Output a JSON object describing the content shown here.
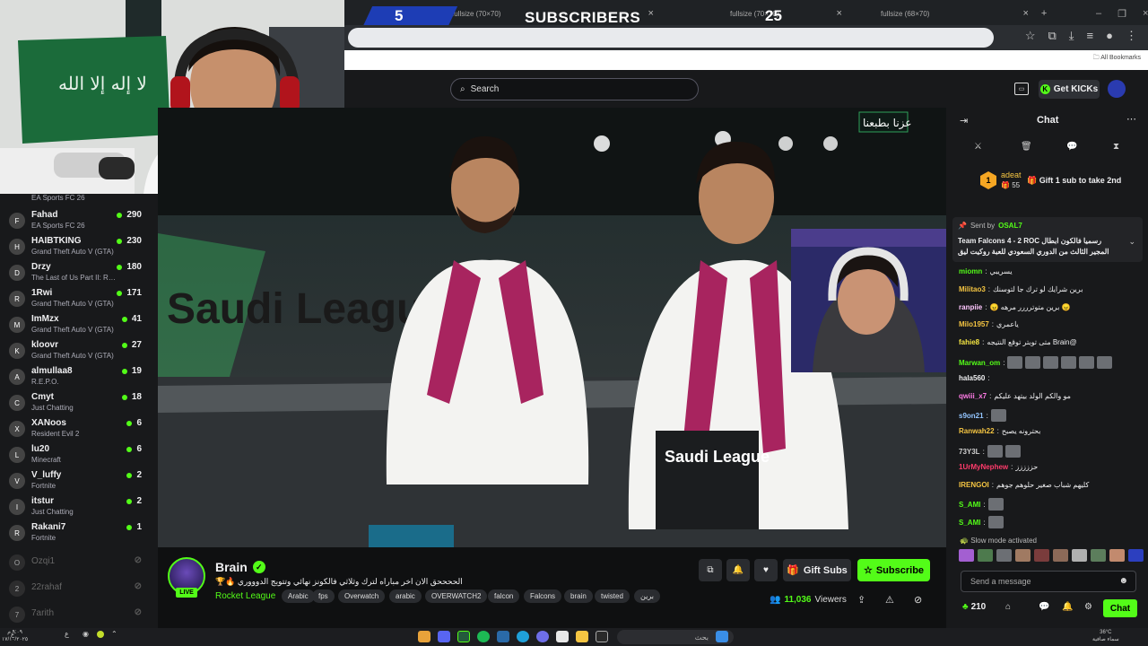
{
  "browser": {
    "tabs": [
      {
        "label": "fullsize (70×70)"
      },
      {
        "label": "fullsize (70×70)"
      },
      {
        "label": "fullsize (68×70)"
      }
    ],
    "bookmarks_label": "All Bookmarks"
  },
  "sub_goal": {
    "left_count": "5",
    "title": "SUBSCRIBERS",
    "right_count": "25",
    "bar_color": "#1d3db5"
  },
  "site": {
    "search_placeholder": "Search",
    "get_kicks": "Get KICKs",
    "accent": "#53fc18"
  },
  "sidebar": {
    "channels": [
      {
        "name": "",
        "game": "EA Sports FC 26",
        "viewers": ""
      },
      {
        "name": "Fahad",
        "game": "EA Sports FC 26",
        "viewers": "290",
        "avatar": "F"
      },
      {
        "name": "HAIBTKING",
        "game": "Grand Theft Auto V (GTA)",
        "viewers": "230",
        "avatar": "H"
      },
      {
        "name": "Drzy",
        "game": "The Last of Us Part II: Remastered",
        "viewers": "180",
        "avatar": "D"
      },
      {
        "name": "1Rwi",
        "game": "Grand Theft Auto V (GTA)",
        "viewers": "171",
        "avatar": "R"
      },
      {
        "name": "ImMzx",
        "game": "Grand Theft Auto V (GTA)",
        "viewers": "41",
        "avatar": "M"
      },
      {
        "name": "kloovr",
        "game": "Grand Theft Auto V (GTA)",
        "viewers": "27",
        "avatar": "K"
      },
      {
        "name": "almullaa8",
        "game": "R.E.P.O.",
        "viewers": "19",
        "avatar": "A"
      },
      {
        "name": "Cmyt",
        "game": "Just Chatting",
        "viewers": "18",
        "avatar": "C"
      },
      {
        "name": "XANoos",
        "game": "Resident Evil 2",
        "viewers": "6",
        "avatar": "X"
      },
      {
        "name": "lu20",
        "game": "Minecraft",
        "viewers": "6",
        "avatar": "L"
      },
      {
        "name": "V_luffy",
        "game": "Fortnite",
        "viewers": "2",
        "avatar": "V"
      },
      {
        "name": "itstur",
        "game": "Just Chatting",
        "viewers": "2",
        "avatar": "I"
      },
      {
        "name": "Rakani7",
        "game": "Fortnite",
        "viewers": "1",
        "avatar": "R"
      }
    ],
    "offline": [
      {
        "name": "Ozqi1",
        "avatar": "O"
      },
      {
        "name": "22rahaf",
        "avatar": "2"
      },
      {
        "name": "7arith",
        "avatar": "7"
      }
    ]
  },
  "stream": {
    "streamer": "Brain",
    "live": "LIVE",
    "title": "الححححق الان اخر مباراه لترك وثلاثي فالكونز نهائي وتتويج الدوووري 🔥🏆",
    "category": "Rocket League",
    "tags": [
      "Arabic",
      "fps",
      "Overwatch",
      "arabic",
      "OVERWATCH2",
      "falcon",
      "Falcons",
      "brain",
      "twisted",
      "برين"
    ],
    "viewers": "11,036",
    "viewers_label": "Viewers",
    "gift_subs": "Gift Subs",
    "subscribe": "Subscribe"
  },
  "video": {
    "sign_text": "عزنا بطبعنا",
    "league_text": "Saudi League"
  },
  "chat": {
    "title": "Chat",
    "leader_name": "adeat",
    "leader_rank": "1",
    "leader_count": "55",
    "leader_cta": "Gift 1 sub to take 2nd",
    "pinned_sender_label": "Sent by",
    "pinned_sender": "OSAL7",
    "pinned_text_1": "رسميا فالكون ابطال Team Falcons 4 - 2 ROC",
    "pinned_text_2": "المجير الثالث من الدوري السعودي للعبة روكيت ليق",
    "messages": [
      {
        "user": "miomn",
        "text": "يسريبي",
        "color": "#53fc18",
        "emotes": 0
      },
      {
        "user": "Militao3",
        "text": "برين شرايك لو ترك جا لتوسنك",
        "color": "#f5c542",
        "emotes": 0
      },
      {
        "user": "ranpiie",
        "text": "😠 برين متوترررر مرهه 😠",
        "color": "#ffc7ff",
        "emotes": 0
      },
      {
        "user": "Milo1957",
        "text": "ياعمري",
        "color": "#f5c542",
        "emotes": 0
      },
      {
        "user": "fahie8",
        "text": "@Brain متى توبتر توقع النتيجه",
        "color": "#f5e642",
        "emotes": 0
      },
      {
        "user": "Marwan_om",
        "text": "",
        "color": "#53fc18",
        "emotes": 6
      },
      {
        "user": "hala560",
        "text": "",
        "color": "#efeff1",
        "emotes": 0
      },
      {
        "user": "qwiii_x7",
        "text": "مو والكم الولد بيتهد عليكم",
        "color": "#ff7ae5",
        "emotes": 0
      },
      {
        "user": "s9on21",
        "text": "",
        "color": "#93c5ff",
        "emotes": 1
      },
      {
        "user": "Ranwah22",
        "text": "بحترونه يصبح",
        "color": "#f5c542",
        "emotes": 0
      },
      {
        "user": "73Y3L",
        "text": "",
        "color": "#d0d0d0",
        "emotes": 2
      },
      {
        "user": "1UrMyNephew",
        "text": "حززززز",
        "color": "#ff3b6b",
        "emotes": 0
      },
      {
        "user": "IRENGOI",
        "text": "كليهم شباب صغير حلوهم جوهم",
        "color": "#f5c542",
        "emotes": 0
      },
      {
        "user": "S_AMI",
        "text": "",
        "color": "#53fc18",
        "emotes": 1
      },
      {
        "user": "S_AMI",
        "text": "",
        "color": "#53fc18",
        "emotes": 1
      }
    ],
    "slow_mode": "Slow mode activated",
    "input_placeholder": "Send a message",
    "points": "210",
    "send_label": "Chat"
  },
  "taskbar": {
    "search_placeholder": "بحث",
    "temp": "36°C",
    "weather": "سماء صافية",
    "time": "٩:٠٩ م",
    "date": "١٧/١٠/٢٠٢٥"
  }
}
